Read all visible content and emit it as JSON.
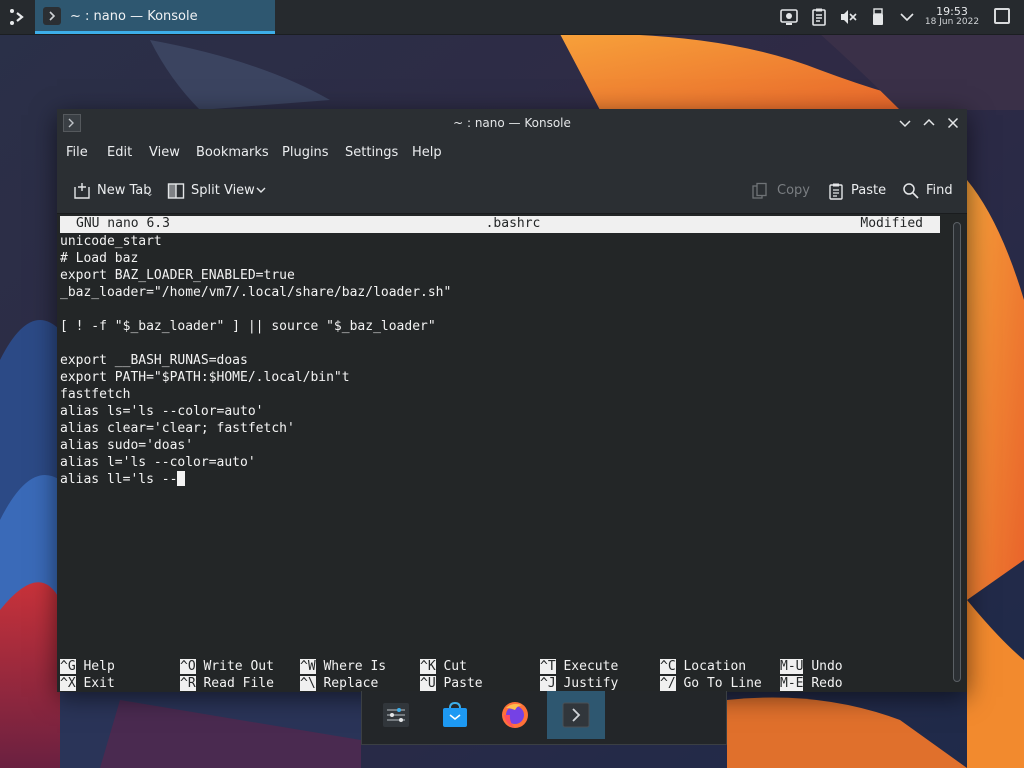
{
  "top_panel": {
    "task_label": "~ : nano — Konsole",
    "clock_time": "19:53",
    "clock_date": "18 Jun 2022",
    "icons": [
      "application-launcher-icon",
      "konsole-icon",
      "screen-recorder-icon",
      "clipboard-icon",
      "volume-muted-icon",
      "removable-device-icon",
      "chevron-down-icon",
      "show-desktop-icon"
    ]
  },
  "window": {
    "title": "~ : nano — Konsole",
    "controls": [
      "minimize-icon",
      "maximize-icon",
      "close-icon"
    ],
    "menu": [
      "File",
      "Edit",
      "View",
      "Bookmarks",
      "Plugins",
      "Settings",
      "Help"
    ],
    "toolbar": {
      "new_tab": "New Tab",
      "split_view": "Split View",
      "copy": "Copy",
      "paste": "Paste",
      "find": "Find"
    }
  },
  "nano": {
    "version": "GNU nano 6.3",
    "filename": ".bashrc",
    "status": "Modified",
    "lines": [
      "unicode_start",
      "# Load baz",
      "export BAZ_LOADER_ENABLED=true",
      "_baz_loader=\"/home/vm7/.local/share/baz/loader.sh\"",
      "",
      "[ ! -f \"$_baz_loader\" ] || source \"$_baz_loader\"",
      "",
      "export __BASH_RUNAS=doas",
      "export PATH=\"$PATH:$HOME/.local/bin\"t",
      "fastfetch",
      "alias ls='ls --color=auto'",
      "alias clear='clear; fastfetch'",
      "alias sudo='doas'",
      "alias l='ls --color=auto'"
    ],
    "current_line": "alias ll='ls --",
    "shortcuts": [
      {
        "key": "^G",
        "label": "Help"
      },
      {
        "key": "^X",
        "label": "Exit"
      },
      {
        "key": "^O",
        "label": "Write Out"
      },
      {
        "key": "^R",
        "label": "Read File"
      },
      {
        "key": "^W",
        "label": "Where Is"
      },
      {
        "key": "^\\",
        "label": "Replace"
      },
      {
        "key": "^K",
        "label": "Cut"
      },
      {
        "key": "^U",
        "label": "Paste"
      },
      {
        "key": "^T",
        "label": "Execute"
      },
      {
        "key": "^J",
        "label": "Justify"
      },
      {
        "key": "^C",
        "label": "Location"
      },
      {
        "key": "^/",
        "label": "Go To Line"
      },
      {
        "key": "M-U",
        "label": "Undo"
      },
      {
        "key": "M-E",
        "label": "Redo"
      }
    ]
  },
  "dock": {
    "items": [
      "system-settings-icon",
      "discover-store-icon",
      "firefox-icon",
      "konsole-icon"
    ],
    "active": "konsole-icon"
  },
  "colors": {
    "panel": "#262a2e",
    "accent": "#3daee9",
    "active_task": "#2e5770",
    "terminal_bg": "#232627",
    "terminal_fg": "#f3f3f3",
    "wallpaper_orange": "#f0822a",
    "wallpaper_blue": "#27345c"
  }
}
